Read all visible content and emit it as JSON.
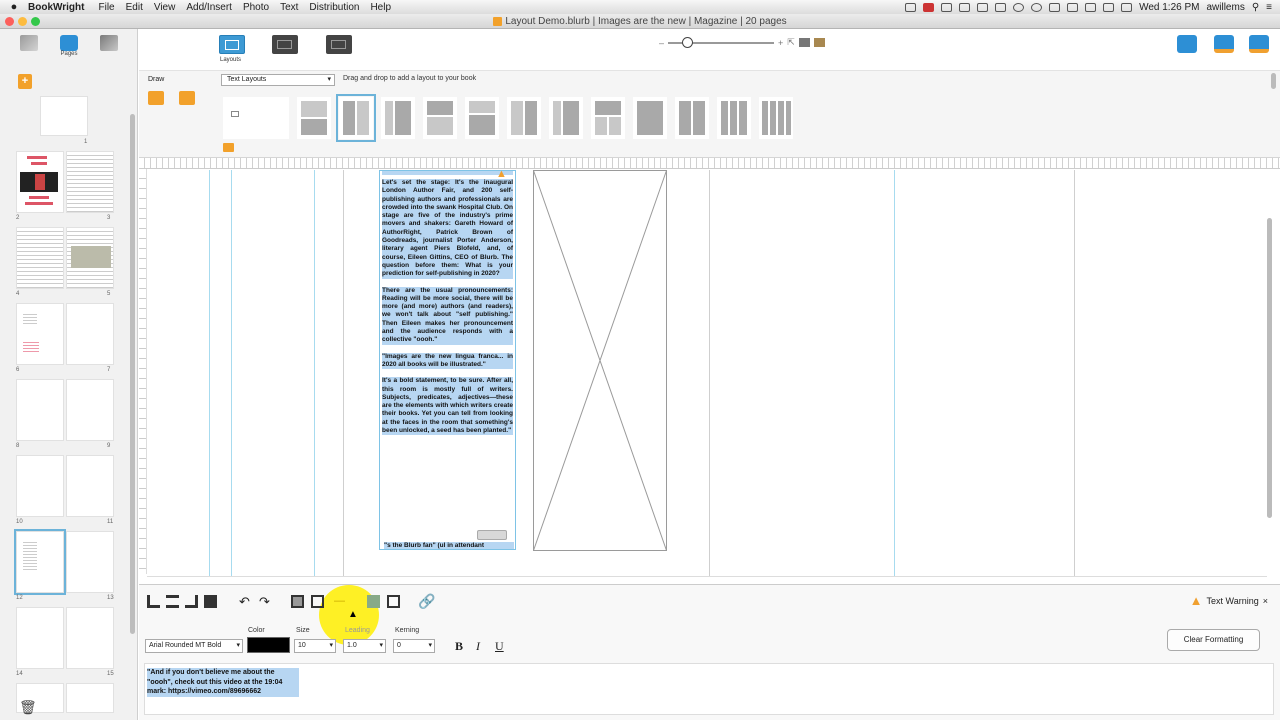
{
  "menubar": {
    "app": "BookWright",
    "items": [
      "File",
      "Edit",
      "View",
      "Add/Insert",
      "Photo",
      "Text",
      "Distribution",
      "Help"
    ],
    "clock": "Wed 1:26 PM",
    "user": "awillems"
  },
  "window": {
    "title": "Layout Demo.blurb | Images are the new | Magazine | 20 pages"
  },
  "left_tools": {
    "pages_label": "Pages"
  },
  "pages": {
    "numbers": [
      "1",
      "2",
      "3",
      "4",
      "5",
      "6",
      "7",
      "8",
      "9",
      "10",
      "11",
      "12",
      "13",
      "14",
      "15"
    ]
  },
  "toolbar": {
    "modes": [
      {
        "label": "Layouts",
        "icon": "layouts-icon"
      },
      {
        "label": "",
        "icon": "photos-icon"
      },
      {
        "label": "",
        "icon": "backgrounds-icon"
      }
    ],
    "zoom_level": 0.15
  },
  "layouts": {
    "draw_label": "Draw",
    "type_select": "Text Layouts",
    "hint": "Drag and drop to add a layout to your book"
  },
  "story": {
    "heading_fragment": "inaugural...",
    "paragraphs": [
      "Let's set the stage: It's the inaugural London Author Fair, and 200 self-publishing authors and professionals are crowded into the swank Hospital Club. On stage are five of the industry's prime movers and shakers: Gareth Howard of AuthorRight, Patrick Brown of Goodreads, journalist Porter Anderson, literary agent Piers Blofeld, and, of course, Eileen Gittins, CEO of Blurb. The question before them: What is your prediction for self-publishing in 2020?",
      "There are the usual pronouncements: Reading will be more social, there will be more (and more) authors (and readers), we won't talk about \"self publishing.\" Then Eileen makes her pronouncement and the audience responds with a collective \"oooh.\"",
      "\"Images are the new lingua franca... in 2020 all books will be illustrated.\"",
      "It's a bold statement, to be sure. After all, this room is mostly full of writers. Subjects, predicates, adjectives—these are the elements with which writers create their books. Yet you can tell from looking at the faces in the room that something's been unlocked, a seed has been planted.\""
    ],
    "overflow_line": "\"s the Blurb fan\" (ul in attendant"
  },
  "format": {
    "font": "Arial Rounded MT Bold",
    "color_label": "Color",
    "color": "#000000",
    "size_label": "Size",
    "size": "10",
    "leading_label": "Leading",
    "leading": "1.0",
    "kerning_label": "Kerning",
    "kerning": "0",
    "bold": "B",
    "italic": "I",
    "underline": "U",
    "clear_button": "Clear Formatting",
    "warning": "Text Warning",
    "warning_close": "×"
  },
  "notes": {
    "text": "\"And if you don't believe me about the \"oooh\", check out this video at the 19:04 mark: https://vimeo.com/89696662"
  },
  "colors": {
    "accent": "#4da6d8",
    "warning": "#f0a030",
    "selection": "#b7d6f2",
    "highlight": "#ffef00"
  }
}
